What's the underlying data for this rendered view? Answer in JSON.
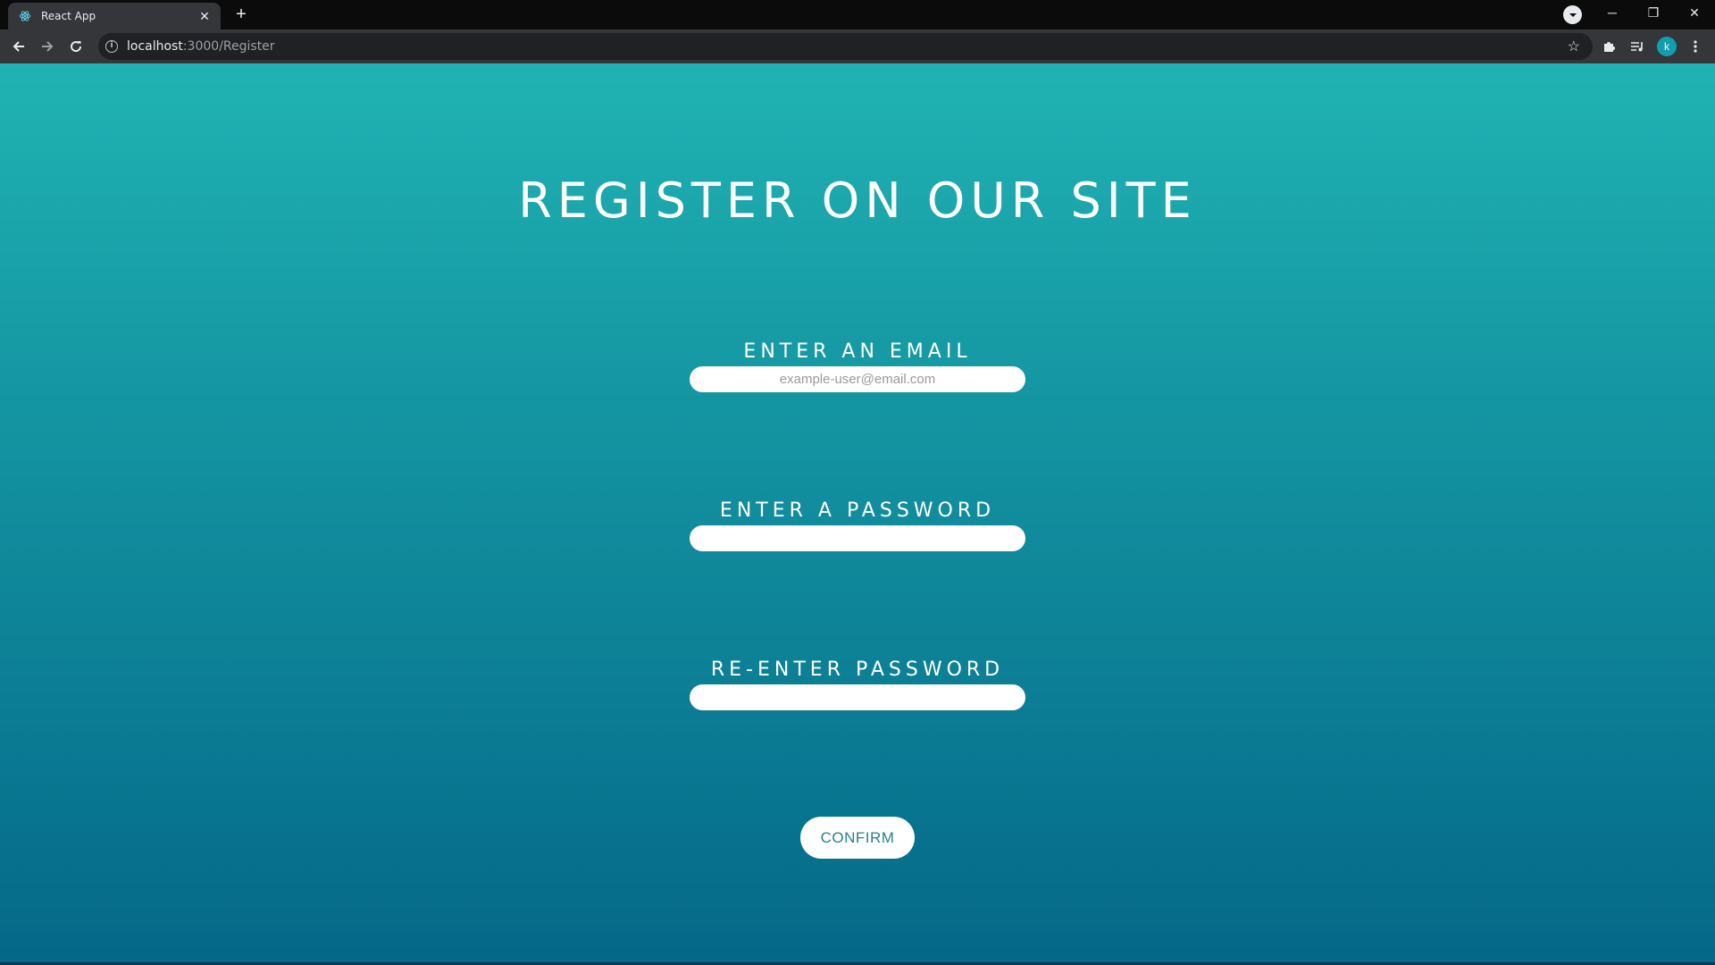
{
  "browser": {
    "tab_title": "React App",
    "tab_close": "✕",
    "new_tab": "+",
    "url_host": "localhost",
    "url_path": ":3000/Register",
    "profile_initial": "k",
    "window_controls": {
      "minimize": "─",
      "restore": "❐",
      "close": "✕"
    },
    "icons": [
      "react-favicon-icon",
      "back-icon",
      "forward-icon",
      "reload-icon",
      "info-icon",
      "star-icon",
      "extensions-icon",
      "media-icon",
      "menu-icon",
      "profile-dropdown-icon"
    ]
  },
  "page": {
    "title": "REGISTER ON OUR SITE",
    "background_top": "#20b3b3",
    "background_bottom": "#046888",
    "fields": [
      {
        "label": "ENTER AN EMAIL",
        "placeholder": "example-user@email.com",
        "value": ""
      },
      {
        "label": "ENTER A PASSWORD",
        "placeholder": "",
        "value": ""
      },
      {
        "label": "RE-ENTER PASSWORD",
        "placeholder": "",
        "value": ""
      }
    ],
    "confirm_label": "CONFIRM",
    "accent_color": "#2a7f94"
  }
}
